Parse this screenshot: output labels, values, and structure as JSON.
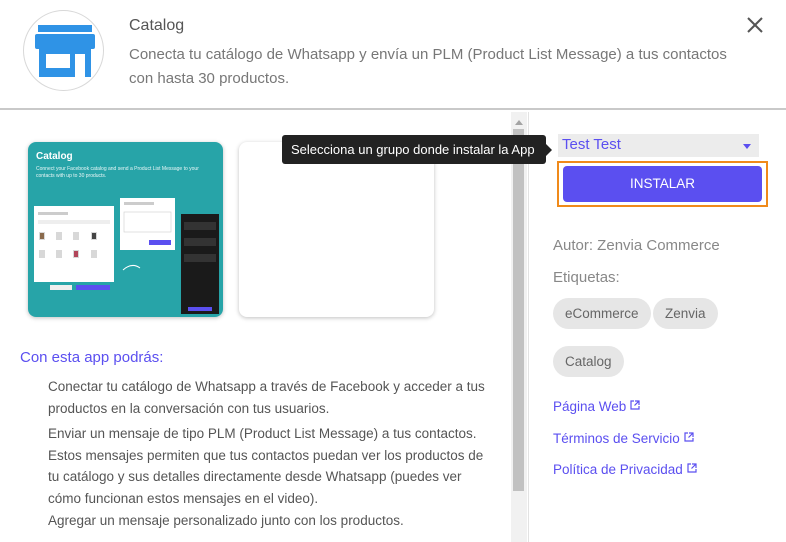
{
  "header": {
    "title": "Catalog",
    "description": "Conecta tu catálogo de Whatsapp y envía un PLM (Product List Message) a tus contactos con hasta 30 productos."
  },
  "preview": {
    "card_title": "Catalog",
    "card_subtitle": "Connect your Facebook catalog and send a Product List Message to your contacts with up to 30 products.",
    "tooltip": "Selecciona un grupo donde instalar la App"
  },
  "features": {
    "title": "Con esta app podrás:",
    "items": [
      "Conectar tu catálogo de Whatsapp a través de Facebook y acceder a tus productos en la conversación con tus usuarios.",
      "Enviar un mensaje de tipo PLM (Product List Message) a tus contactos. Estos mensajes permiten que tus contactos puedan ver los productos de tu catálogo y sus detalles directamente desde Whatsapp (puedes ver cómo funcionan estos mensajes en el video).",
      "Agregar un mensaje personalizado junto con los productos."
    ]
  },
  "sidebar": {
    "group_select": "Test Test",
    "install_label": "INSTALAR",
    "author": "Autor: Zenvia Commerce",
    "tags_label": "Etiquetas:",
    "tags": [
      "eCommerce",
      "Zenvia",
      "Catalog"
    ],
    "links": [
      "Página Web",
      "Términos de Servicio",
      "Política de Privacidad"
    ]
  },
  "colors": {
    "accent": "#5b4ff0",
    "highlight_border": "#f08a1a",
    "logo_blue": "#2f93e6",
    "preview_teal": "#27a4a8"
  },
  "icons": {
    "logo": "storefront-icon",
    "close": "close-icon",
    "external": "external-link-icon"
  }
}
